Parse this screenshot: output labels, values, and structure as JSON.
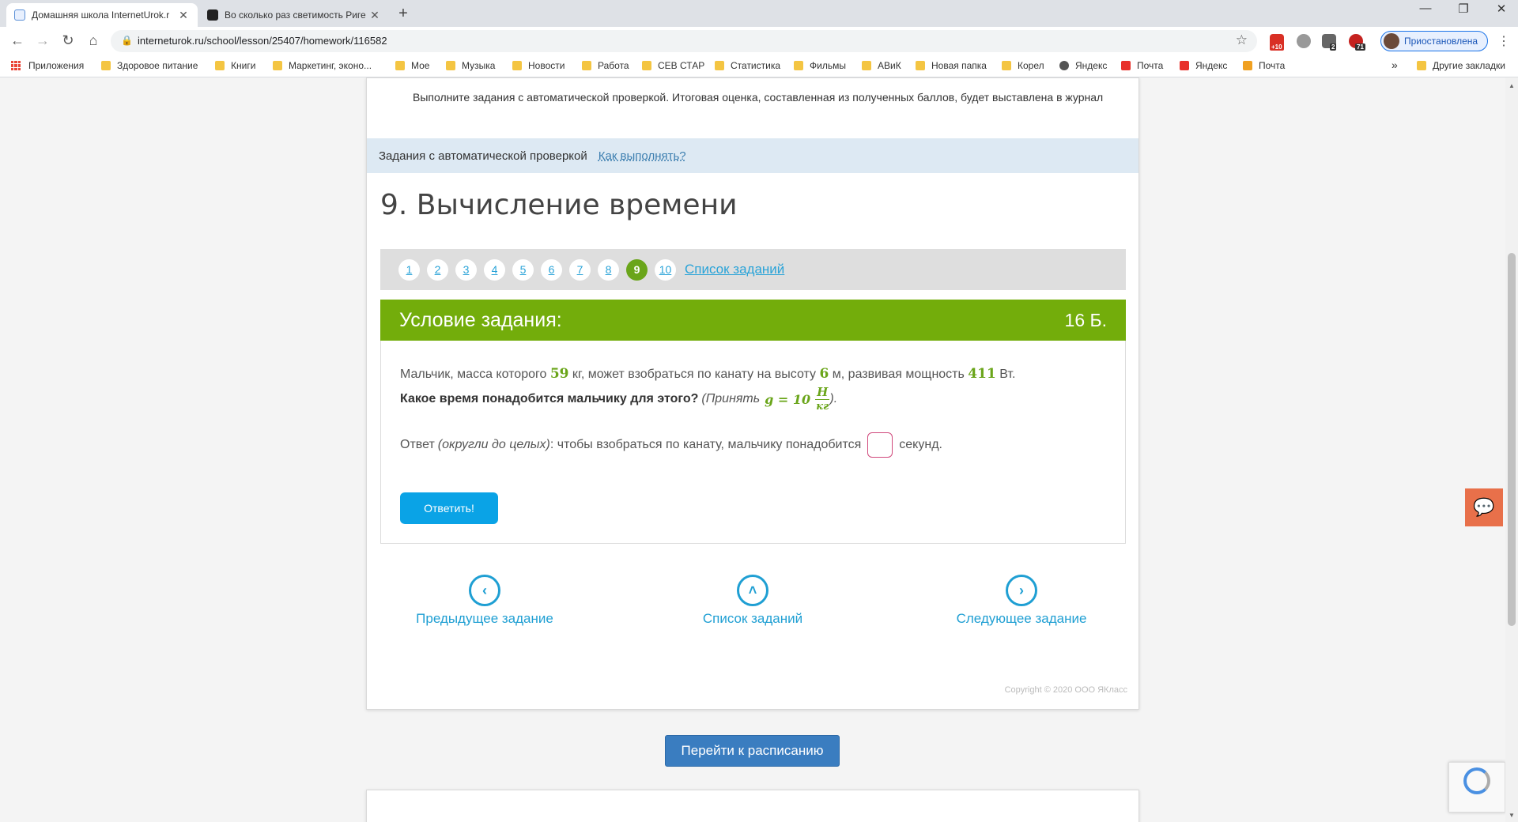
{
  "browser": {
    "tabs": [
      {
        "title": "Домашняя школа InternetUrok.r",
        "active": true
      },
      {
        "title": "Во сколько раз светимость Риге",
        "active": false
      }
    ],
    "url": "interneturok.ru/school/lesson/25407/homework/116582",
    "profile_label": "Приостановлена",
    "ext_badges": [
      "+10",
      "2",
      "71"
    ],
    "bookmarks": [
      {
        "label": "Приложения",
        "type": "apps"
      },
      {
        "label": "Здоровое питание",
        "type": "folder"
      },
      {
        "label": "Книги",
        "type": "folder"
      },
      {
        "label": "Маркетинг, эконо...",
        "type": "folder"
      },
      {
        "label": "Мое",
        "type": "folder"
      },
      {
        "label": "Музыка",
        "type": "folder"
      },
      {
        "label": "Новости",
        "type": "folder"
      },
      {
        "label": "Работа",
        "type": "folder"
      },
      {
        "label": "СЕВ СТАР",
        "type": "folder"
      },
      {
        "label": "Статистика",
        "type": "folder"
      },
      {
        "label": "Фильмы",
        "type": "folder"
      },
      {
        "label": "АВиК",
        "type": "folder"
      },
      {
        "label": "Новая папка",
        "type": "folder"
      },
      {
        "label": "Корел",
        "type": "folder"
      },
      {
        "label": "Яндекс",
        "type": "globe"
      },
      {
        "label": "Почта",
        "type": "yandex"
      },
      {
        "label": "Яндекс",
        "type": "yandex"
      },
      {
        "label": "Почта",
        "type": "mail"
      }
    ],
    "overflow": "»",
    "other_bookmarks": "Другие закладки"
  },
  "page": {
    "instructions": "Выполните задания с автоматической проверкой. Итоговая оценка, составленная из полученных баллов, будет выставлена в журнал",
    "autocheck_label": "Задания с автоматической проверкой",
    "how_to_link": "Как выполнять?",
    "title": "9. Вычисление времени",
    "pager": {
      "pages": [
        "1",
        "2",
        "3",
        "4",
        "5",
        "6",
        "7",
        "8",
        "9",
        "10"
      ],
      "current": "9",
      "list_link": "Список заданий"
    },
    "condition": {
      "header": "Условие задания:",
      "points": "16 Б.",
      "q1_a": "Мальчик, масса которого ",
      "mass": "59",
      "q1_b": " кг, может взобраться по канату на высоту ",
      "height": "6",
      "q1_c": " м, развивая мощность ",
      "power": "411",
      "q1_d": " Вт.",
      "q2_bold": "Какое время понадобится мальчику для этого?",
      "q2_hint": "(Принять",
      "g_formula": "g = 10",
      "frac_num": "Н",
      "frac_den": "кг",
      "q2_close": ").",
      "ans_a": "Ответ ",
      "ans_hint": "(округли до целых)",
      "ans_b": ": чтобы взобраться по канату, мальчику понадобится",
      "ans_unit": "секунд.",
      "submit": "Ответить!"
    },
    "bottom_nav": {
      "prev": "Предыдущее задание",
      "list": "Список заданий",
      "next": "Следующее задание"
    },
    "copyright": "Copyright © 2020 ООО ЯКласс",
    "schedule_button": "Перейти к расписанию"
  },
  "accent_green": "#73ad0b",
  "accent_blue": "#1f9fd3"
}
